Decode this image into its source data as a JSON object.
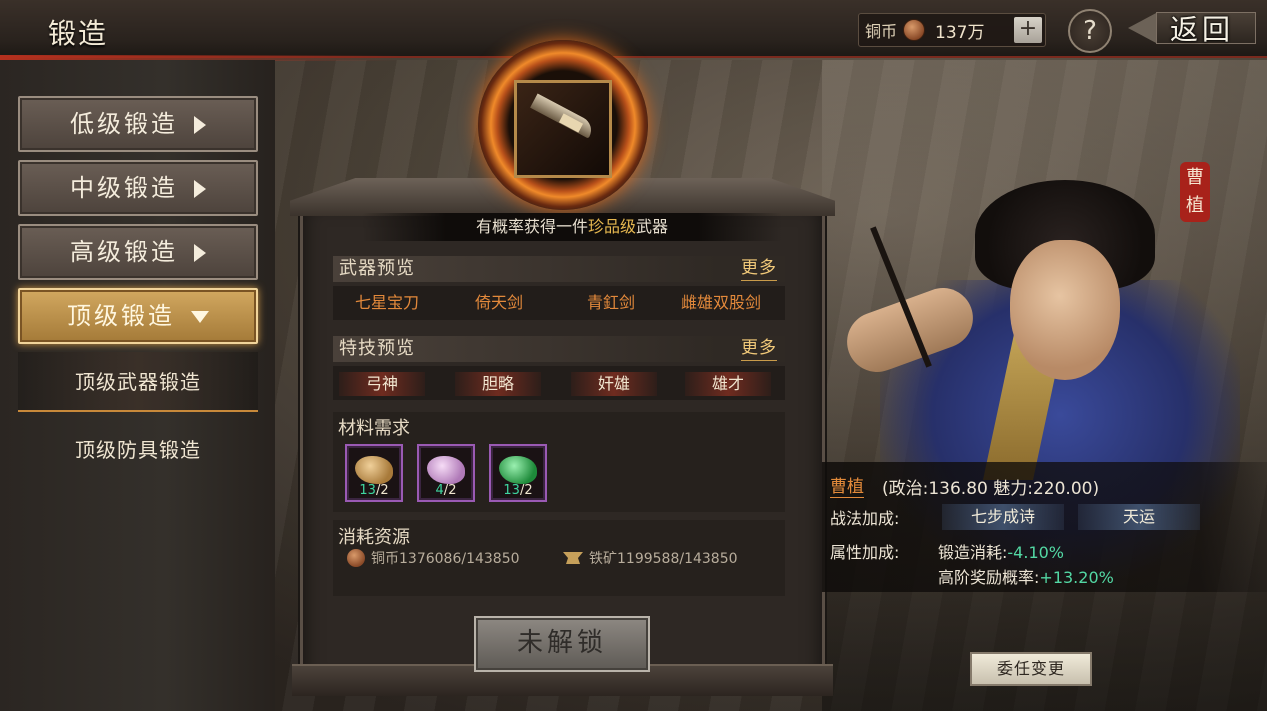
{
  "header": {
    "title": "锻造",
    "coin_label": "铜币",
    "coin_value": "137万",
    "plus": "+",
    "help": "?",
    "back": "返回"
  },
  "nav": {
    "items": [
      {
        "label": "低级锻造"
      },
      {
        "label": "中级锻造"
      },
      {
        "label": "高级锻造"
      },
      {
        "label": "顶级锻造"
      }
    ],
    "sub_items": [
      {
        "label": "顶级武器锻造"
      },
      {
        "label": "顶级防具锻造"
      }
    ]
  },
  "forge": {
    "prob_prefix": "有概率获得一件",
    "prob_highlight": "珍品级",
    "prob_suffix": "武器",
    "weapons_title": "武器预览",
    "weapons_more": "更多",
    "weapons": [
      "七星宝刀",
      "倚天剑",
      "青釭剑",
      "雌雄双股剑"
    ],
    "skills_title": "特技预览",
    "skills_more": "更多",
    "skills": [
      "弓神",
      "胆略",
      "奸雄",
      "雄才"
    ],
    "materials_title": "材料需求",
    "materials": [
      {
        "have": "13",
        "need": "2",
        "color": "#c89a5a"
      },
      {
        "have": "4",
        "need": "2",
        "color": "#d8a8d8"
      },
      {
        "have": "13",
        "need": "2",
        "color": "#3ac46a"
      }
    ],
    "cost_title": "消耗资源",
    "cost_coin": "铜币1376086/143850",
    "cost_iron": "铁矿1199588/143850",
    "unlock": "未解锁"
  },
  "character": {
    "seal_1": "曹",
    "seal_2": "植",
    "name": "曹植",
    "stats": "(政治:136.80 魅力:220.00)",
    "tactic_label": "战法加成:",
    "tactics": [
      "七步成诗",
      "天运"
    ],
    "attr_label": "属性加成:",
    "attr_1_label": "锻造消耗:",
    "attr_1_value": "-4.10%",
    "attr_2_label": "高阶奖励概率:",
    "attr_2_value": "+13.20%",
    "appoint": "委任变更"
  }
}
